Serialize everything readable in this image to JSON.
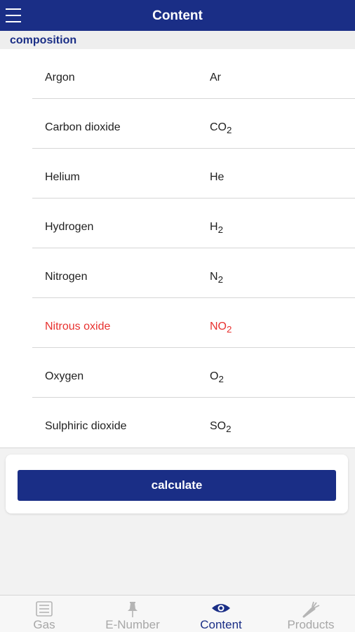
{
  "header": {
    "title": "Content"
  },
  "section": {
    "title": "composition"
  },
  "gases": [
    {
      "name": "Argon",
      "formula": "Ar",
      "sub": ""
    },
    {
      "name": "Carbon dioxide",
      "formula": "CO",
      "sub": "2"
    },
    {
      "name": "Helium",
      "formula": "He",
      "sub": ""
    },
    {
      "name": "Hydrogen",
      "formula": "H",
      "sub": "2"
    },
    {
      "name": "Nitrogen",
      "formula": "N",
      "sub": "2"
    },
    {
      "name": "Nitrous oxide",
      "formula": "NO",
      "sub": "2"
    },
    {
      "name": "Oxygen",
      "formula": "O",
      "sub": "2"
    },
    {
      "name": "Sulphiric dioxide",
      "formula": "SO",
      "sub": "2"
    }
  ],
  "highlight_color": "#e8312f",
  "accent_color": "#1a2e86",
  "actions": {
    "calculate_label": "calculate"
  },
  "tabs": [
    {
      "label": "Gas",
      "icon": "list-icon",
      "active": false
    },
    {
      "label": "E-Number",
      "icon": "pin-icon",
      "active": false
    },
    {
      "label": "Content",
      "icon": "eye-icon",
      "active": true
    },
    {
      "label": "Products",
      "icon": "carrot-icon",
      "active": false
    }
  ]
}
